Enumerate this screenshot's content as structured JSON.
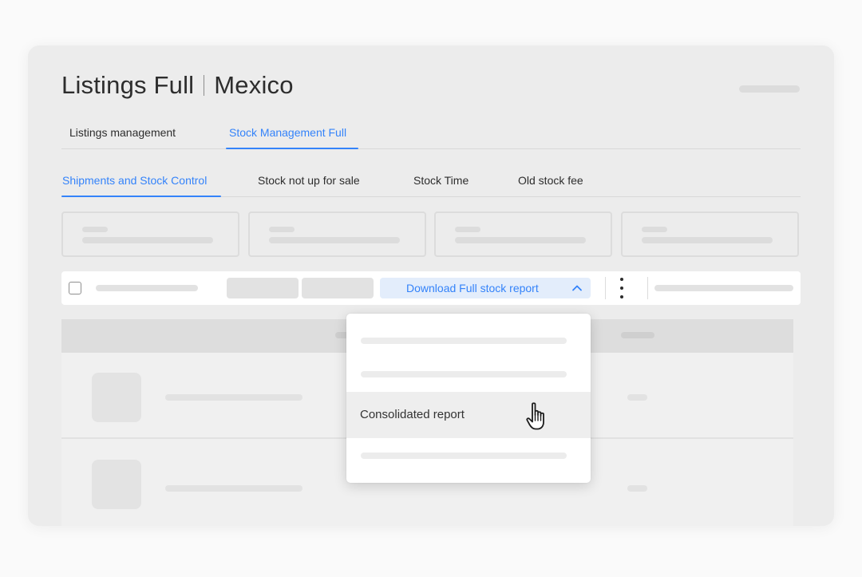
{
  "header": {
    "title_left": "Listings Full",
    "title_right": "Mexico"
  },
  "main_tabs": [
    {
      "label": "Listings management",
      "active": false
    },
    {
      "label": "Stock Management Full",
      "active": true
    }
  ],
  "sub_tabs": [
    {
      "label": "Shipments and Stock Control",
      "active": true
    },
    {
      "label": "Stock not up for sale",
      "active": false
    },
    {
      "label": "Stock Time",
      "active": false
    },
    {
      "label": "Old stock fee",
      "active": false
    }
  ],
  "toolbar": {
    "download_label": "Download Full stock report",
    "download_icon": "chevron-up-icon",
    "more_icon": "kebab-menu-icon"
  },
  "dropdown": {
    "items": [
      {
        "label": "",
        "placeholder": true
      },
      {
        "label": "",
        "placeholder": true
      },
      {
        "label": "Consolidated report",
        "placeholder": false,
        "hovered": true
      },
      {
        "label": "",
        "placeholder": true
      }
    ]
  },
  "colors": {
    "accent": "#3483fa",
    "accent_bg": "#e3edfb",
    "card_bg": "#ececec"
  },
  "icons": {
    "cursor": "hand-pointer-icon"
  }
}
